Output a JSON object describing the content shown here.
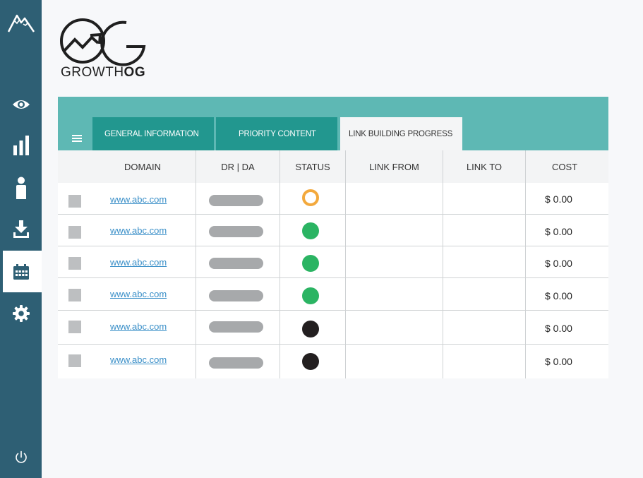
{
  "sidebar": {
    "items": [
      {
        "icon": "mountain-logo-icon"
      },
      {
        "icon": "eye-icon"
      },
      {
        "icon": "bar-chart-icon"
      },
      {
        "icon": "user-icon"
      },
      {
        "icon": "download-icon"
      },
      {
        "icon": "calendar-icon",
        "active": true
      },
      {
        "icon": "gear-icon"
      },
      {
        "icon": "power-icon"
      }
    ]
  },
  "logo": {
    "text_part1": "GROWTH",
    "text_part2": "OG"
  },
  "tabs": [
    {
      "label": "GENERAL INFORMATION",
      "active": false
    },
    {
      "label": "PRIORITY CONTENT",
      "active": false
    },
    {
      "label": "LINK BUILDING PROGRESS",
      "active": true
    }
  ],
  "table": {
    "columns": [
      "DOMAIN",
      "DR | DA",
      "STATUS",
      "LINK FROM",
      "LINK TO",
      "COST"
    ],
    "rows": [
      {
        "domain": "www.abc.com",
        "status": "pending",
        "cost": "$ 0.00"
      },
      {
        "domain": "www.abc.com",
        "status": "done",
        "cost": "$ 0.00"
      },
      {
        "domain": "www.abc.com",
        "status": "done",
        "cost": "$ 0.00"
      },
      {
        "domain": "www.abc.com",
        "status": "done",
        "cost": "$ 0.00"
      },
      {
        "domain": "www.abc.com",
        "status": "inactive",
        "cost": "$ 0.00"
      },
      {
        "domain": "www.abc.com",
        "status": "inactive",
        "cost": "$ 0.00"
      }
    ]
  },
  "colors": {
    "sidebar": "#2e5f74",
    "tabbar": "#5eb8b4",
    "tab_dark": "#22978f",
    "status_pending": "#f3a93d",
    "status_done": "#2bb463",
    "status_inactive": "#231f20",
    "link": "#3a8fc8"
  }
}
